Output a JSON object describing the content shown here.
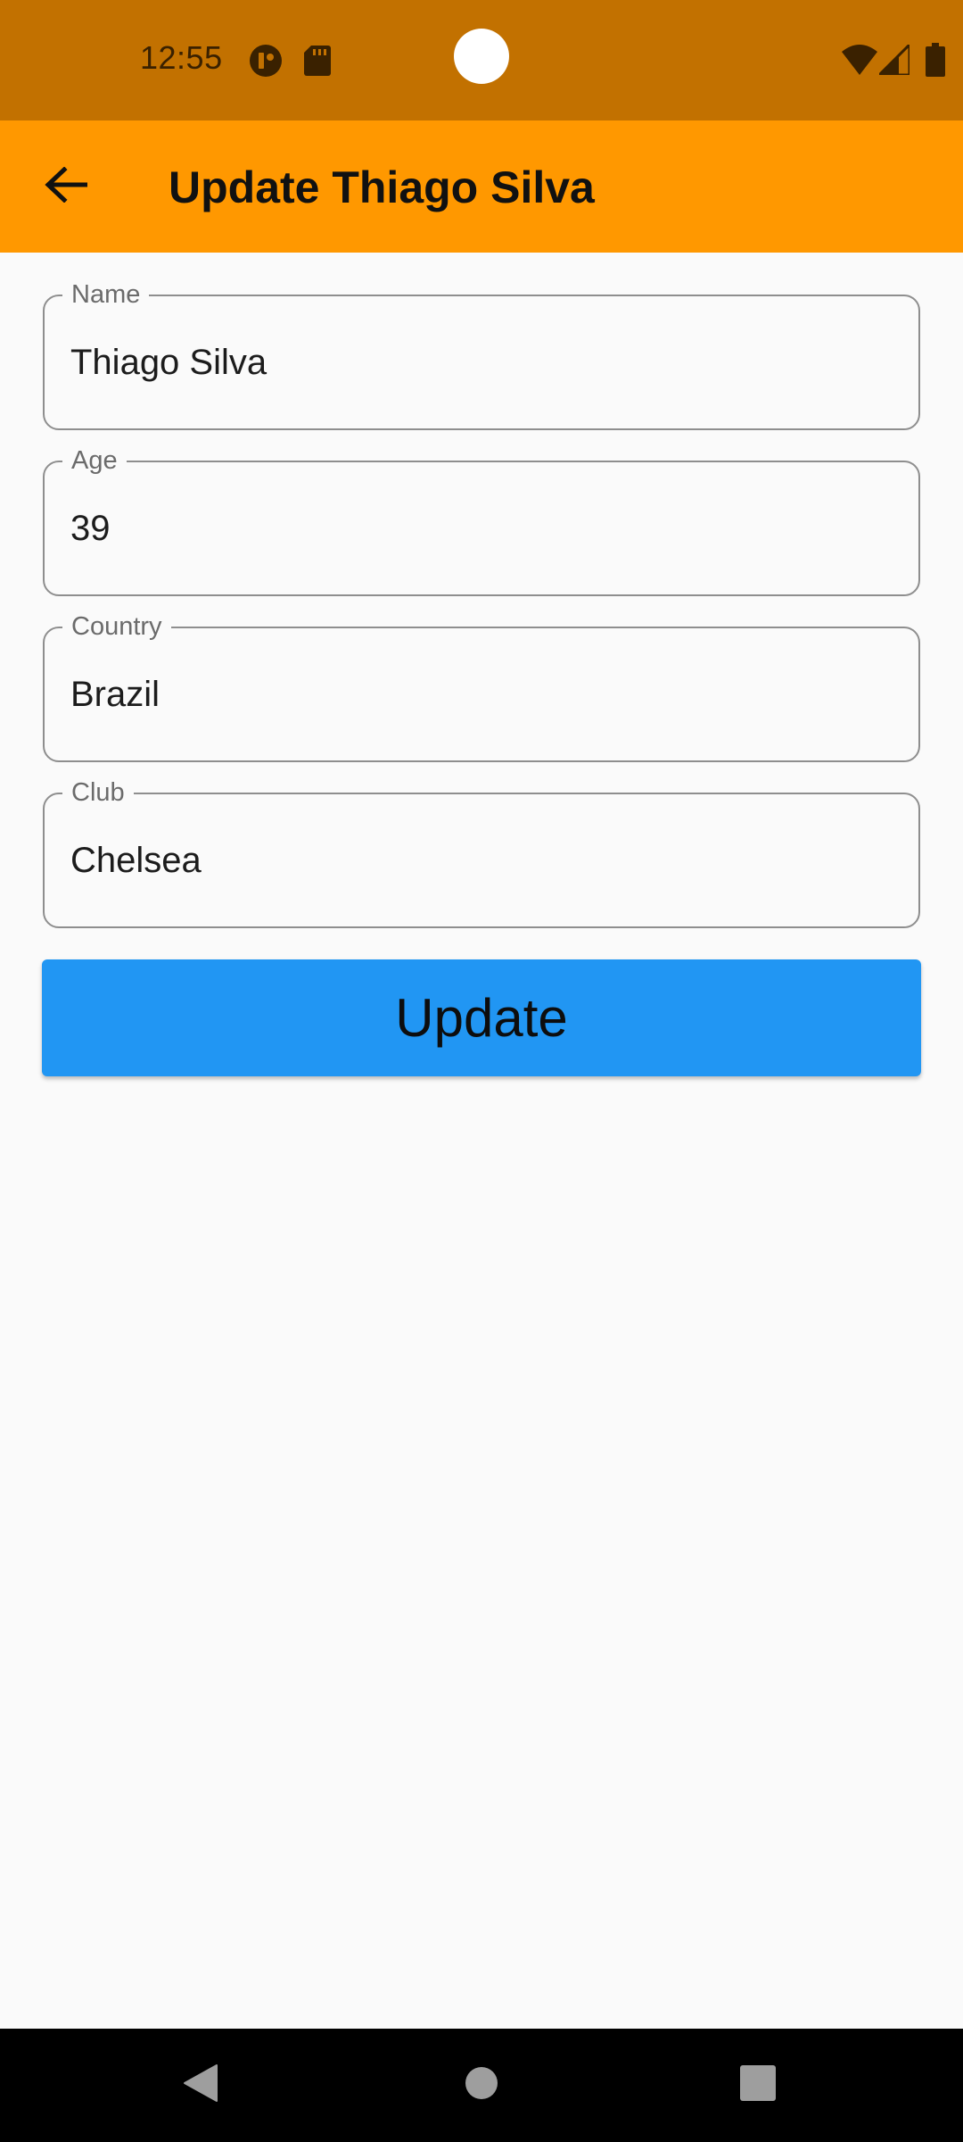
{
  "status_bar": {
    "time": "12:55",
    "icons": [
      "notification-app-icon",
      "sd-card-icon",
      "wifi-icon",
      "cell-signal-icon",
      "battery-icon"
    ],
    "background": "#c27100"
  },
  "app_bar": {
    "title": "Update Thiago Silva",
    "back_icon": "arrow-back-icon",
    "background": "#ff9800"
  },
  "form": {
    "fields": [
      {
        "label": "Name",
        "value": "Thiago Silva"
      },
      {
        "label": "Age",
        "value": "39"
      },
      {
        "label": "Country",
        "value": "Brazil"
      },
      {
        "label": "Club",
        "value": "Chelsea"
      }
    ],
    "submit_label": "Update",
    "submit_color": "#2196f3"
  },
  "nav_bar": {
    "buttons": [
      "back-triangle-icon",
      "home-circle-icon",
      "recents-square-icon"
    ]
  }
}
